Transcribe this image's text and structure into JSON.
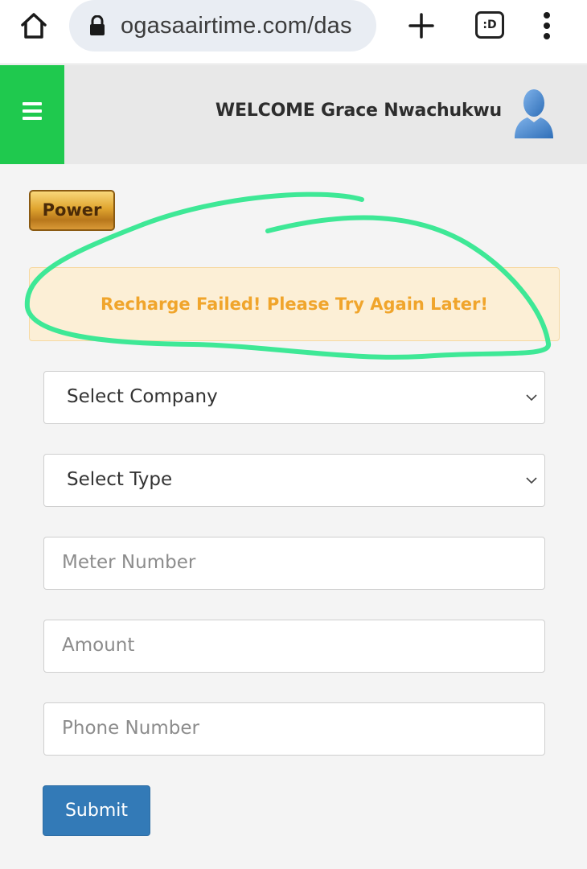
{
  "browser": {
    "url": "ogasaairtime.com/das",
    "tabs_label": ":D"
  },
  "header": {
    "welcome": "WELCOME Grace Nwachukwu"
  },
  "service_badge": "Power",
  "alert": {
    "message": "Recharge Failed! Please Try Again Later!"
  },
  "form": {
    "company_select": "Select Company",
    "type_select": "Select Type",
    "meter_placeholder": "Meter Number",
    "amount_placeholder": "Amount",
    "phone_placeholder": "Phone Number",
    "submit_label": "Submit"
  },
  "colors": {
    "menu_green": "#1fc94e",
    "alert_text": "#f0a52c",
    "submit_blue": "#337ab7",
    "scribble": "#3ee896"
  }
}
